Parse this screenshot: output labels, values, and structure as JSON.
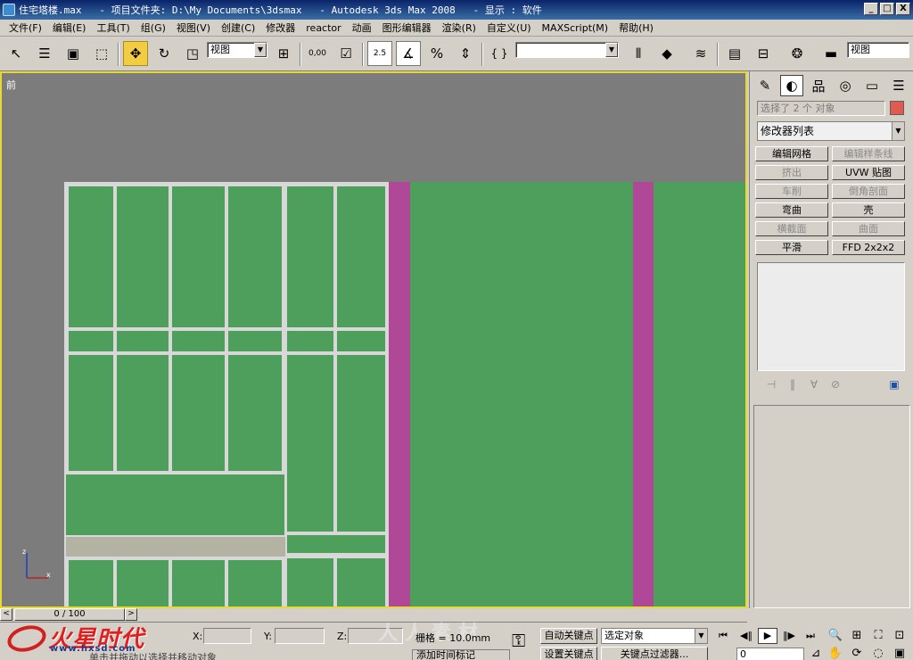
{
  "titlebar": {
    "text": "住宅塔楼.max   - 项目文件夹: D:\\My Documents\\3dsmax   - Autodesk 3ds Max 2008   - 显示 : 软件",
    "min": "_",
    "max": "□",
    "close": "X"
  },
  "menu": [
    "文件(F)",
    "编辑(E)",
    "工具(T)",
    "组(G)",
    "视图(V)",
    "创建(C)",
    "修改器",
    "reactor",
    "动画",
    "图形编辑器",
    "渲染(R)",
    "自定义(U)",
    "MAXScript(M)",
    "帮助(H)"
  ],
  "toolbar": {
    "ref_coord": "视图",
    "snap_angle": "2.5",
    "spinner_snap": "0,00",
    "selection_sets": "",
    "render_dropdown": "视图",
    "named_selection_icon": "{ }"
  },
  "viewport": {
    "label": "前",
    "colors": {
      "background": "#7c7c7c",
      "mesh": "#4e9e5c",
      "magenta": "#b04898",
      "grid": "#d8d8d8",
      "border": "#e8d830"
    }
  },
  "command_panel": {
    "selection_text": "选择了 2 个 对象",
    "selection_color": "#e05a50",
    "modifier_list": "修改器列表",
    "buttons": [
      {
        "label": "编辑网格",
        "enabled": true
      },
      {
        "label": "编辑样条线",
        "enabled": false
      },
      {
        "label": "挤出",
        "enabled": false
      },
      {
        "label": "UVW 贴图",
        "enabled": true
      },
      {
        "label": "车削",
        "enabled": false
      },
      {
        "label": "倒角剖面",
        "enabled": false
      },
      {
        "label": "弯曲",
        "enabled": true
      },
      {
        "label": "壳",
        "enabled": true
      },
      {
        "label": "横截面",
        "enabled": false
      },
      {
        "label": "曲面",
        "enabled": false
      },
      {
        "label": "平滑",
        "enabled": true
      },
      {
        "label": "FFD 2x2x2",
        "enabled": true
      }
    ]
  },
  "timeline": {
    "frame": "0 / 100",
    "left_arrow": "<",
    "right_arrow": ">"
  },
  "status": {
    "x_label": "X:",
    "y_label": "Y:",
    "z_label": "Z:",
    "grid": "栅格 = 10.0mm",
    "message": "单击并拖动以选择并移动对象",
    "add_time_tag": "添加时间标记",
    "auto_key": "自动关键点",
    "set_key": "设置关键点",
    "selected_object": "选定对象",
    "key_filters": "关键点过滤器...",
    "current_frame": "0",
    "watermark": "人人素材"
  },
  "logo": {
    "main": "火星时代",
    "url": "www.hxsd.com"
  }
}
